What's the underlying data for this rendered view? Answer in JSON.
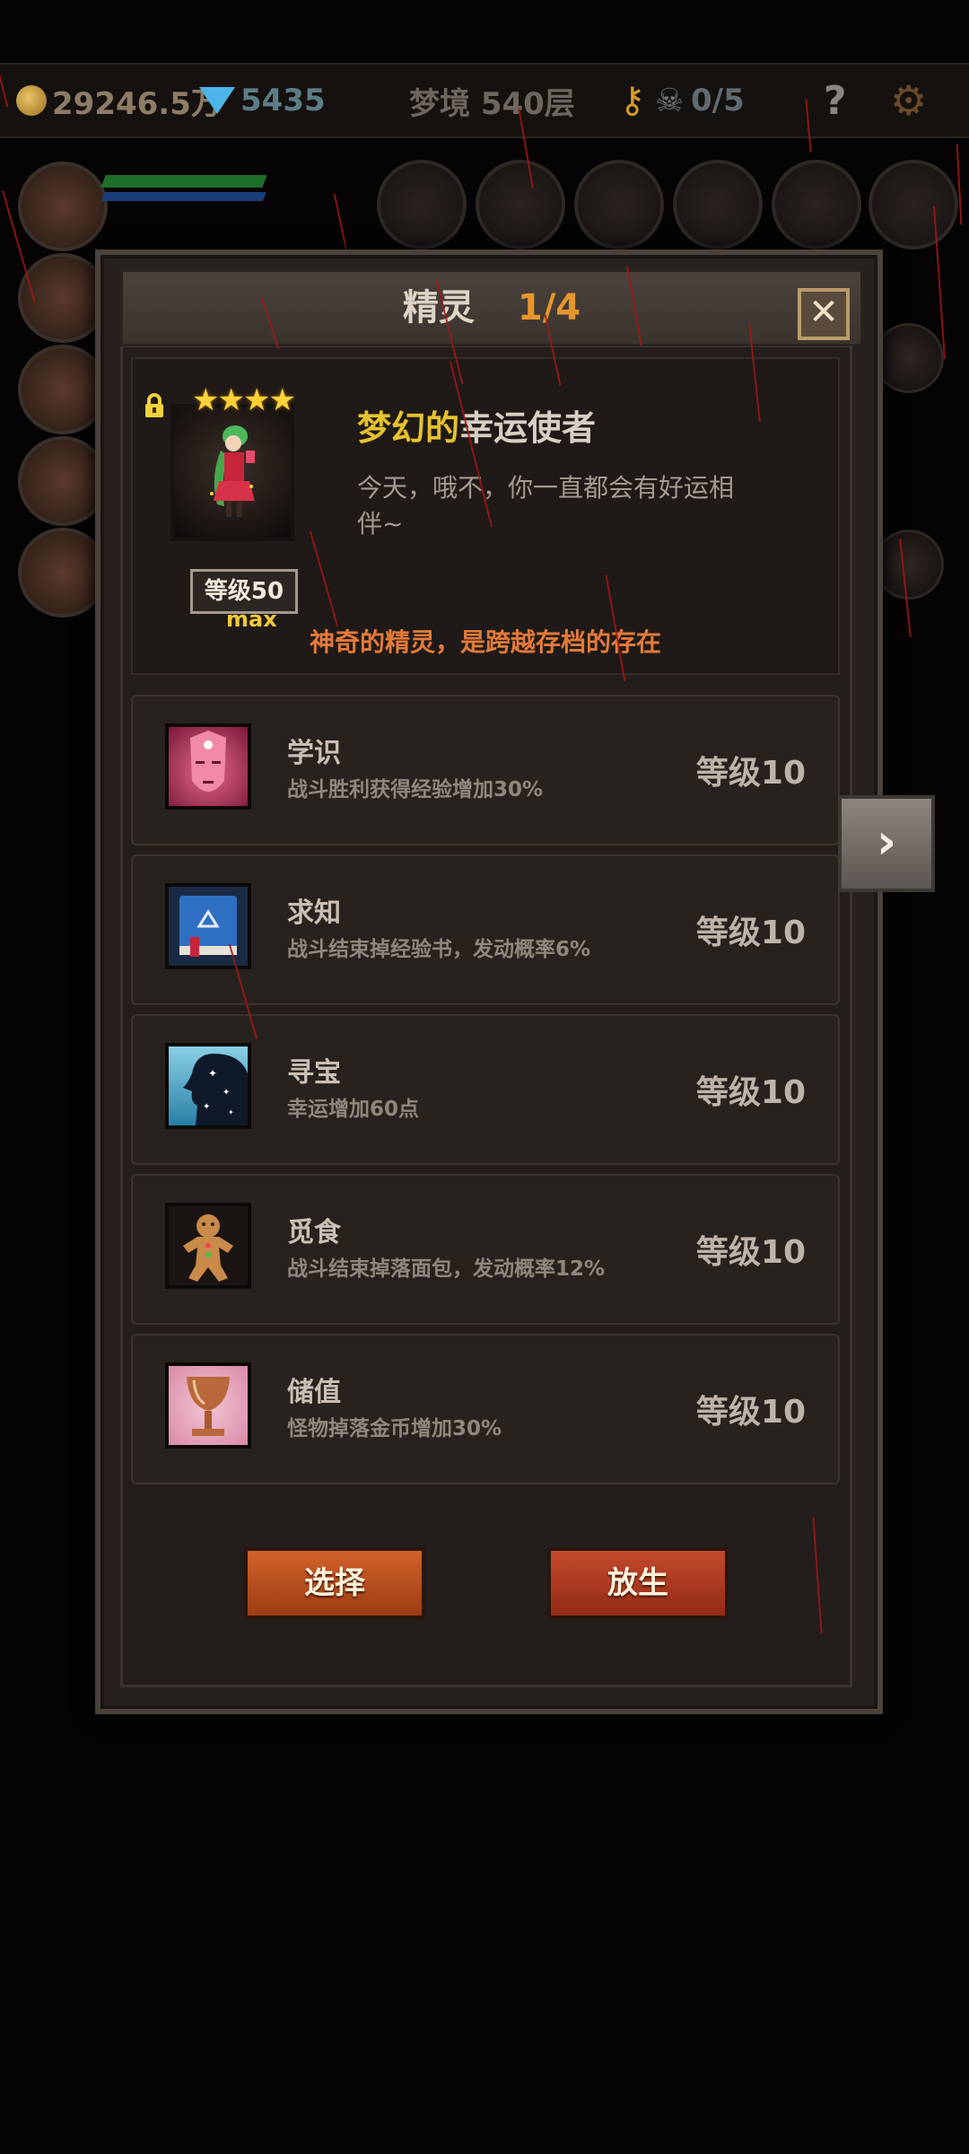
{
  "top_bar": {
    "gold": "29246.5万",
    "gems": "5435",
    "floor": "梦境 540层",
    "key_count": "0/5",
    "help_label": "?",
    "icons": [
      "coin-icon",
      "gem-icon",
      "key-icon",
      "skull-icon",
      "help-icon",
      "gear-icon"
    ]
  },
  "dialog": {
    "title": "精灵",
    "page": "1/4",
    "close_label": "✕",
    "spirit": {
      "stars": "★★★★",
      "level_badge": "等级50",
      "max_label": "max",
      "name_part1": "梦幻的",
      "name_part2": "幸运使者",
      "description": "今天，哦不，你一直都会有好运相伴~",
      "note": "神奇的精灵，是跨越存档的存在"
    },
    "skills": [
      {
        "name": "学识",
        "desc": "战斗胜利获得经验增加30%",
        "level": "等级10",
        "icon": "mask-face-icon"
      },
      {
        "name": "求知",
        "desc": "战斗结束掉经验书，发动概率6%",
        "level": "等级10",
        "icon": "book-icon"
      },
      {
        "name": "寻宝",
        "desc": "幸运增加60点",
        "level": "等级10",
        "icon": "starry-silhouette-icon"
      },
      {
        "name": "觅食",
        "desc": "战斗结束掉落面包，发动概率12%",
        "level": "等级10",
        "icon": "gingerbread-icon"
      },
      {
        "name": "储值",
        "desc": "怪物掉落金币增加30%",
        "level": "等级10",
        "icon": "goblet-icon"
      }
    ],
    "buttons": {
      "select": "选择",
      "release": "放生"
    }
  },
  "next_arrow": "›",
  "colors": {
    "accent_orange": "#e6962c",
    "name_gold": "#e6c22e",
    "note_orange": "#e37a3a",
    "star_yellow": "#ffd23a"
  }
}
